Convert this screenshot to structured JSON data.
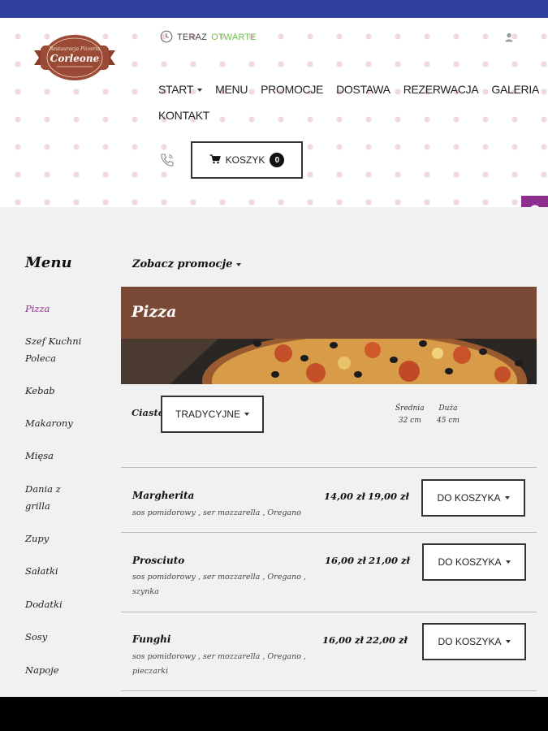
{
  "header": {
    "logo": {
      "line1": "Restauracja Pizzeria",
      "line2": "Corleone"
    },
    "status_prefix": "TERAZ",
    "status_value": "OTWARTE",
    "nav": [
      {
        "label": "START",
        "dropdown": true
      },
      {
        "label": "MENU"
      },
      {
        "label": "PROMOCJE"
      },
      {
        "label": "DOSTAWA"
      },
      {
        "label": "REZERWACJA"
      },
      {
        "label": "GALERIA"
      },
      {
        "label": "KONTAKT"
      }
    ],
    "cart_label": "KOSZYK",
    "cart_count": "0"
  },
  "sidebar": {
    "title": "Menu",
    "items": [
      {
        "label": "Pizza",
        "active": true
      },
      {
        "label": "Szef Kuchni Poleca"
      },
      {
        "label": "Kebab"
      },
      {
        "label": "Makarony"
      },
      {
        "label": "Mięsa"
      },
      {
        "label": "Dania z grilla"
      },
      {
        "label": "Zupy"
      },
      {
        "label": "Sałatki"
      },
      {
        "label": "Dodatki"
      },
      {
        "label": "Sosy"
      },
      {
        "label": "Napoje"
      }
    ]
  },
  "main": {
    "promo_link": "Zobacz promocje",
    "category_title": "Pizza",
    "dough_label": "Ciasto",
    "dough_value": "TRADYCYJNE",
    "sizes": [
      {
        "label": "Średnia",
        "size": "32 cm"
      },
      {
        "label": "Duża",
        "size": "45 cm"
      }
    ],
    "add_label": "DO KOSZYKA",
    "products": [
      {
        "name": "Margherita",
        "desc": "sos pomidorowy , ser mozzarella , Oregano",
        "price_medium": "14,00 zł",
        "price_large": "19,00 zł"
      },
      {
        "name": "Prosciuto",
        "desc": "sos pomidorowy , ser mozzarella , Oregano , szynka",
        "price_medium": "16,00 zł",
        "price_large": "21,00 zł"
      },
      {
        "name": "Funghi",
        "desc": "sos pomidorowy , ser mozzarella , Oregano , pieczarki",
        "price_medium": "16,00 zł",
        "price_large": "22,00 zł"
      }
    ]
  },
  "colors": {
    "topbar": "#303f9f",
    "accent_purple": "#8e2f8f",
    "banner_brown": "#7b4a36",
    "open_green": "#6cbf4a"
  },
  "icons": [
    "clock-icon",
    "user-icon",
    "phone-icon",
    "cart-icon",
    "info-icon",
    "caret-down-icon"
  ]
}
